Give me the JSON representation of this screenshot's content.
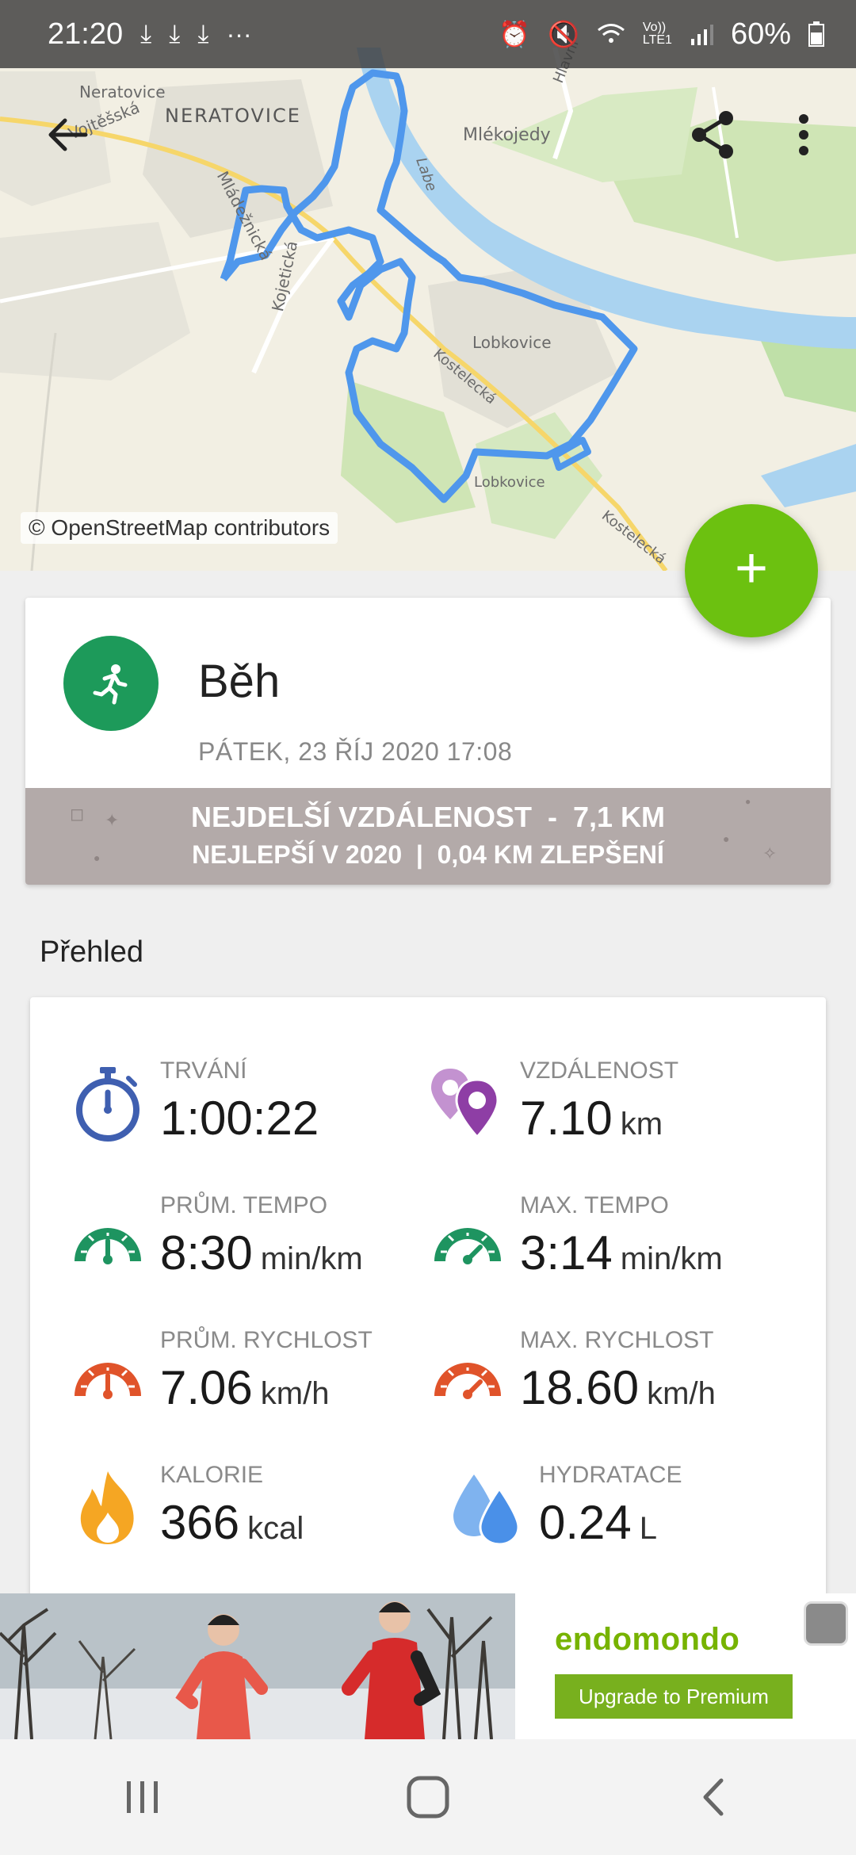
{
  "status_bar": {
    "time": "21:20",
    "left_icons": [
      "download-icon",
      "download-icon",
      "download-icon",
      "more-dots-icon"
    ],
    "right_icons": [
      "alarm-icon",
      "mute-icon",
      "wifi-icon",
      "volte-icon",
      "signal-icon"
    ],
    "volte_label": "Vo))\nLTE1",
    "battery": "60%"
  },
  "map": {
    "credit": "© OpenStreetMap contributors",
    "place_labels": {
      "neratovice_small": "Neratovice",
      "vojtesska": "Vojtěšská",
      "neratovice": "NERATOVICE",
      "mlekojedy": "Mlékojedy",
      "mladeznicka": "Mládežnická",
      "kojetice": "Kojetická",
      "labe": "Labe",
      "hlavni": "Hlavní",
      "lobkovice1": "Lobkovice",
      "kostelecka1": "Kostelecká",
      "lobkovice2": "Lobkovice",
      "kostelecka2": "Kostelecká"
    },
    "route_color": "#4f97ec"
  },
  "toolbar": {
    "back_icon": "arrow-left-icon",
    "share_icon": "share-icon",
    "menu_icon": "more-vertical-icon"
  },
  "fab": {
    "label": "+"
  },
  "activity": {
    "type": "Běh",
    "date": "PÁTEK, 23 ŘÍJ 2020 17:08",
    "icon": "running-icon",
    "record_line1": "NEJDELŠÍ VZDÁLENOST  -  7,1 KM",
    "record_line2": "NEJLEPŠÍ V 2020  |  0,04 KM ZLEPŠENÍ"
  },
  "overview": {
    "title": "Přehled",
    "stats": [
      {
        "label": "TRVÁNÍ",
        "value": "1:00:22",
        "unit": "",
        "icon": "stopwatch-icon"
      },
      {
        "label": "VZDÁLENOST",
        "value": "7.10",
        "unit": "km",
        "icon": "location-pins-icon"
      },
      {
        "label": "PRŮM. TEMPO",
        "value": "8:30",
        "unit": "min/km",
        "icon": "speedometer-icon"
      },
      {
        "label": "MAX. TEMPO",
        "value": "3:14",
        "unit": "min/km",
        "icon": "speedometer-icon"
      },
      {
        "label": "PRŮM. RYCHLOST",
        "value": "7.06",
        "unit": "km/h",
        "icon": "speedometer-icon"
      },
      {
        "label": "MAX. RYCHLOST",
        "value": "18.60",
        "unit": "km/h",
        "icon": "speedometer-icon"
      },
      {
        "label": "KALORIE",
        "value": "366",
        "unit": "kcal",
        "icon": "flame-icon"
      },
      {
        "label": "HYDRATACE",
        "value": "0.24",
        "unit": "L",
        "icon": "water-drops-icon"
      }
    ],
    "colors": {
      "duration": "#3f5fb0",
      "distance": "#8e3ea5",
      "tempo": "#1e9460",
      "speed": "#e0532a",
      "calories": "#f5a623",
      "hydration": "#4a90e8"
    }
  },
  "ad": {
    "logo": "endomondo",
    "cta": "Upgrade to Premium"
  },
  "nav": {
    "recents_icon": "recents-icon",
    "home_icon": "home-icon",
    "back_icon": "back-chevron-icon"
  }
}
